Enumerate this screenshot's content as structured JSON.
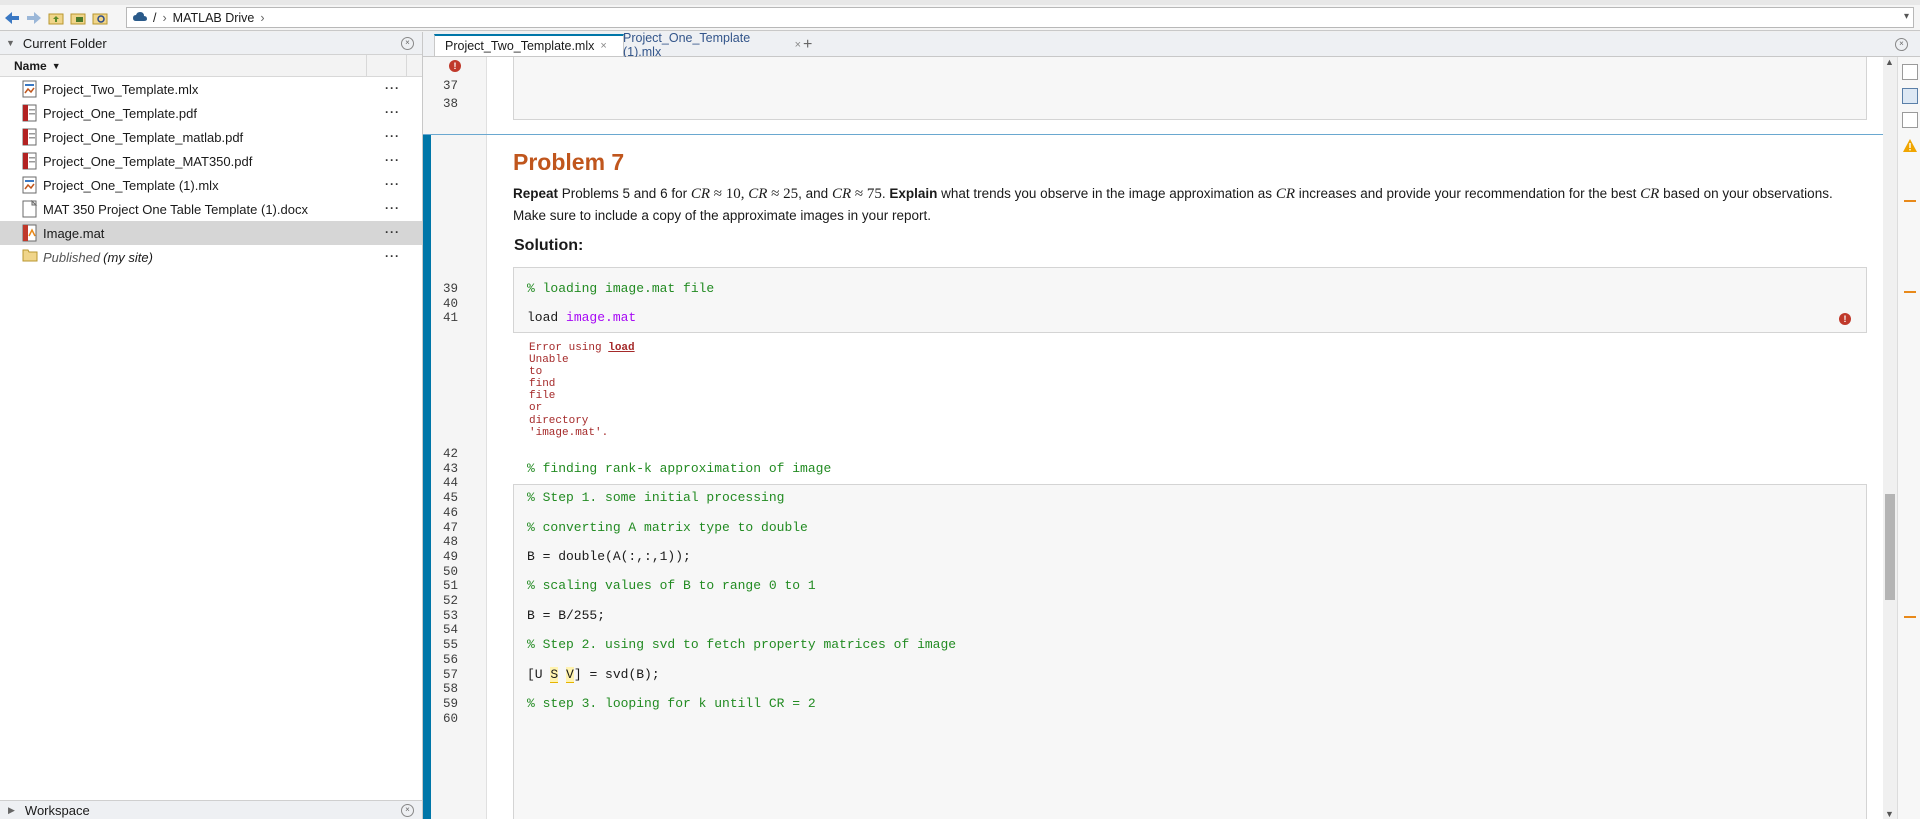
{
  "address": {
    "root": "/",
    "crumb": "MATLAB Drive",
    "chevron": "›",
    "dropdown": "▾"
  },
  "left_panel": {
    "title": "Current Folder",
    "column_name": "Name",
    "files": [
      {
        "name": "Project_Two_Template.mlx",
        "type": "mlx",
        "selected": false
      },
      {
        "name": "Project_One_Template.pdf",
        "type": "pdf",
        "selected": false
      },
      {
        "name": "Project_One_Template_matlab.pdf",
        "type": "pdf",
        "selected": false
      },
      {
        "name": "Project_One_Template_MAT350.pdf",
        "type": "pdf",
        "selected": false
      },
      {
        "name": "Project_One_Template (1).mlx",
        "type": "mlx",
        "selected": false
      },
      {
        "name": "MAT 350 Project One Table Template (1).docx",
        "type": "docx",
        "selected": false
      },
      {
        "name": "Image.mat",
        "type": "mat",
        "selected": true
      }
    ],
    "published": {
      "label": "Published",
      "suffix": "(my site)"
    },
    "dots": "···",
    "workspace": "Workspace"
  },
  "tabs": [
    {
      "label": "Project_Two_Template.mlx",
      "active": true
    },
    {
      "label": "Project_One_Template (1).mlx",
      "active": false
    }
  ],
  "tab_close": "×",
  "tab_add": "+",
  "editor": {
    "top_lines": [
      "37",
      "38"
    ],
    "problem": {
      "title": "Problem 7",
      "repeat": "Repeat",
      "text1": " Problems 5 and 6 for ",
      "cr": "CR",
      "approx": " ≈ ",
      "v10": "10",
      "v25": "25",
      "v75": "75",
      "comma": ", ",
      "and": ", and ",
      "period": ". ",
      "explain": "Explain",
      "text2": " what trends you observe in the image approximation as ",
      "text3": " increases and provide your recommendation for the best ",
      "text4": " based on your observations. Make sure to include a copy of the approximate images in your report.",
      "solution": "Solution:"
    },
    "block1": [
      {
        "n": "39",
        "text": "% loading image.mat file",
        "kind": "comment"
      },
      {
        "n": "40",
        "text": "",
        "kind": "plain"
      },
      {
        "n": "41",
        "text": "load ",
        "kind": "plain",
        "arg": "image.mat"
      }
    ],
    "error": {
      "prefix": "Error using ",
      "link": "load",
      "words": [
        "Unable",
        "to",
        "find",
        "file",
        "or",
        "directory",
        "'image.mat'."
      ]
    },
    "block2": [
      {
        "n": "42",
        "text": ""
      },
      {
        "n": "43",
        "text": "% finding rank-k approximation of image",
        "kind": "comment"
      },
      {
        "n": "44",
        "text": ""
      },
      {
        "n": "45",
        "text": "% Step 1. some initial processing",
        "kind": "comment"
      },
      {
        "n": "46",
        "text": ""
      },
      {
        "n": "47",
        "text": "% converting A matrix type to double",
        "kind": "comment"
      },
      {
        "n": "48",
        "text": ""
      },
      {
        "n": "49",
        "text": "B = double(A(:,:,1));",
        "kind": "plain"
      },
      {
        "n": "50",
        "text": ""
      },
      {
        "n": "51",
        "text": "% scaling values of B to range 0 to 1",
        "kind": "comment"
      },
      {
        "n": "52",
        "text": ""
      },
      {
        "n": "53",
        "text": "B = B/255;",
        "kind": "plain"
      },
      {
        "n": "54",
        "text": ""
      },
      {
        "n": "55",
        "text": "% Step 2. using svd to fetch property matrices of image",
        "kind": "comment"
      },
      {
        "n": "56",
        "text": ""
      },
      {
        "n": "57",
        "text": "[U S V] = svd(B);",
        "kind": "svd"
      },
      {
        "n": "58",
        "text": ""
      },
      {
        "n": "59",
        "text": "% step 3. looping for k untill CR = 2",
        "kind": "comment"
      },
      {
        "n": "60",
        "text": ""
      }
    ],
    "svd_parts": {
      "a": "[U ",
      "s": "S",
      "sp": " ",
      "v": "V",
      "b": "] = svd(B);"
    },
    "error_glyph": "!"
  },
  "colors": {
    "accent": "#0076a8",
    "problem_title": "#c0561d",
    "comment": "#228b22",
    "string": "#a709f5",
    "error": "#c0392b",
    "marker": "#e8891a"
  }
}
